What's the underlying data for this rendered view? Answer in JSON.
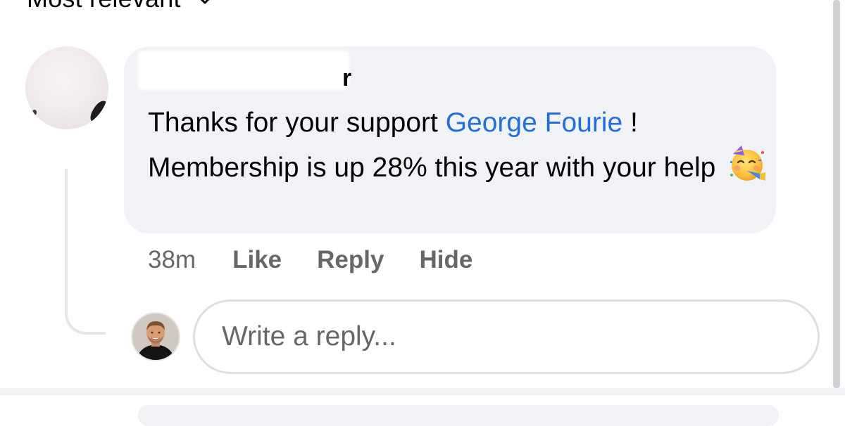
{
  "sort": {
    "label": "Most relevant",
    "icon": "chevron-down-icon"
  },
  "comment": {
    "author_visible": "r",
    "text_before_mention": "Thanks for your support ",
    "mention": "George Fourie",
    "text_after_mention": " ! Membership is up 28% this year with your help",
    "emoji": "partying-face-icon",
    "time": "38m",
    "actions": {
      "like": "Like",
      "reply": "Reply",
      "hide": "Hide"
    }
  },
  "reply_box": {
    "placeholder": "Write a reply...",
    "value": ""
  },
  "colors": {
    "bubble": "#f0f2f5",
    "mention": "#216fdb",
    "secondary_text": "#65676b",
    "primary_text": "#050505"
  }
}
